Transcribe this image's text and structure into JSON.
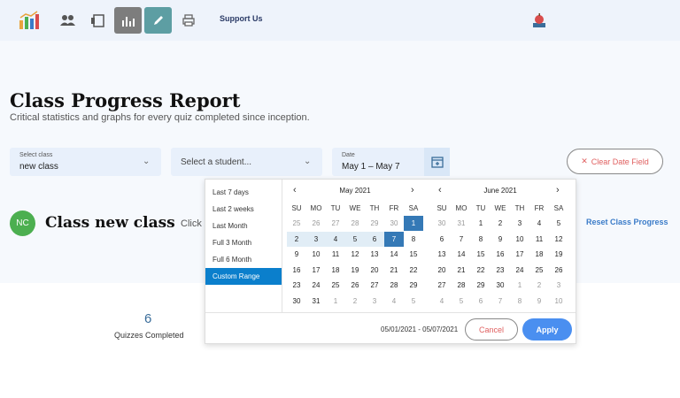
{
  "nav": {
    "support_label": "Support Us"
  },
  "header": {
    "title": "Class Progress Report",
    "subtitle": "Critical statistics and graphs for every quiz completed since inception."
  },
  "filters": {
    "class": {
      "label": "Select class",
      "value": "new class"
    },
    "student": {
      "placeholder": "Select a student..."
    },
    "date": {
      "label": "Date",
      "value": "May 1 – May 7"
    },
    "clear_label": "Clear Date Field"
  },
  "class_section": {
    "avatar_initials": "NC",
    "name": "Class new class",
    "click_text": "Click",
    "reset_label": "Reset Class Progress"
  },
  "stats": {
    "quizzes_completed_value": "6",
    "quizzes_completed_label": "Quizzes Completed"
  },
  "picker": {
    "ranges": [
      "Last 7 days",
      "Last 2 weeks",
      "Last Month",
      "Full 3 Month",
      "Full 6 Month",
      "Custom Range"
    ],
    "selected_range": "Custom Range",
    "weekdays": [
      "SU",
      "MO",
      "TU",
      "WE",
      "TH",
      "FR",
      "SA"
    ],
    "left_month": {
      "title": "May 2021",
      "weeks": [
        [
          "25",
          "26",
          "27",
          "28",
          "29",
          "30",
          "1"
        ],
        [
          "2",
          "3",
          "4",
          "5",
          "6",
          "7",
          "8"
        ],
        [
          "9",
          "10",
          "11",
          "12",
          "13",
          "14",
          "15"
        ],
        [
          "16",
          "17",
          "18",
          "19",
          "20",
          "21",
          "22"
        ],
        [
          "23",
          "24",
          "25",
          "26",
          "27",
          "28",
          "29"
        ],
        [
          "30",
          "31",
          "1",
          "2",
          "3",
          "4",
          "5"
        ]
      ]
    },
    "right_month": {
      "title": "June 2021",
      "weeks": [
        [
          "30",
          "31",
          "1",
          "2",
          "3",
          "4",
          "5"
        ],
        [
          "6",
          "7",
          "8",
          "9",
          "10",
          "11",
          "12"
        ],
        [
          "13",
          "14",
          "15",
          "16",
          "17",
          "18",
          "19"
        ],
        [
          "20",
          "21",
          "22",
          "23",
          "24",
          "25",
          "26"
        ],
        [
          "27",
          "28",
          "29",
          "30",
          "1",
          "2",
          "3"
        ],
        [
          "4",
          "5",
          "6",
          "7",
          "8",
          "9",
          "10"
        ]
      ]
    },
    "range_text": "05/01/2021 - 05/07/2021",
    "cancel_label": "Cancel",
    "apply_label": "Apply"
  }
}
